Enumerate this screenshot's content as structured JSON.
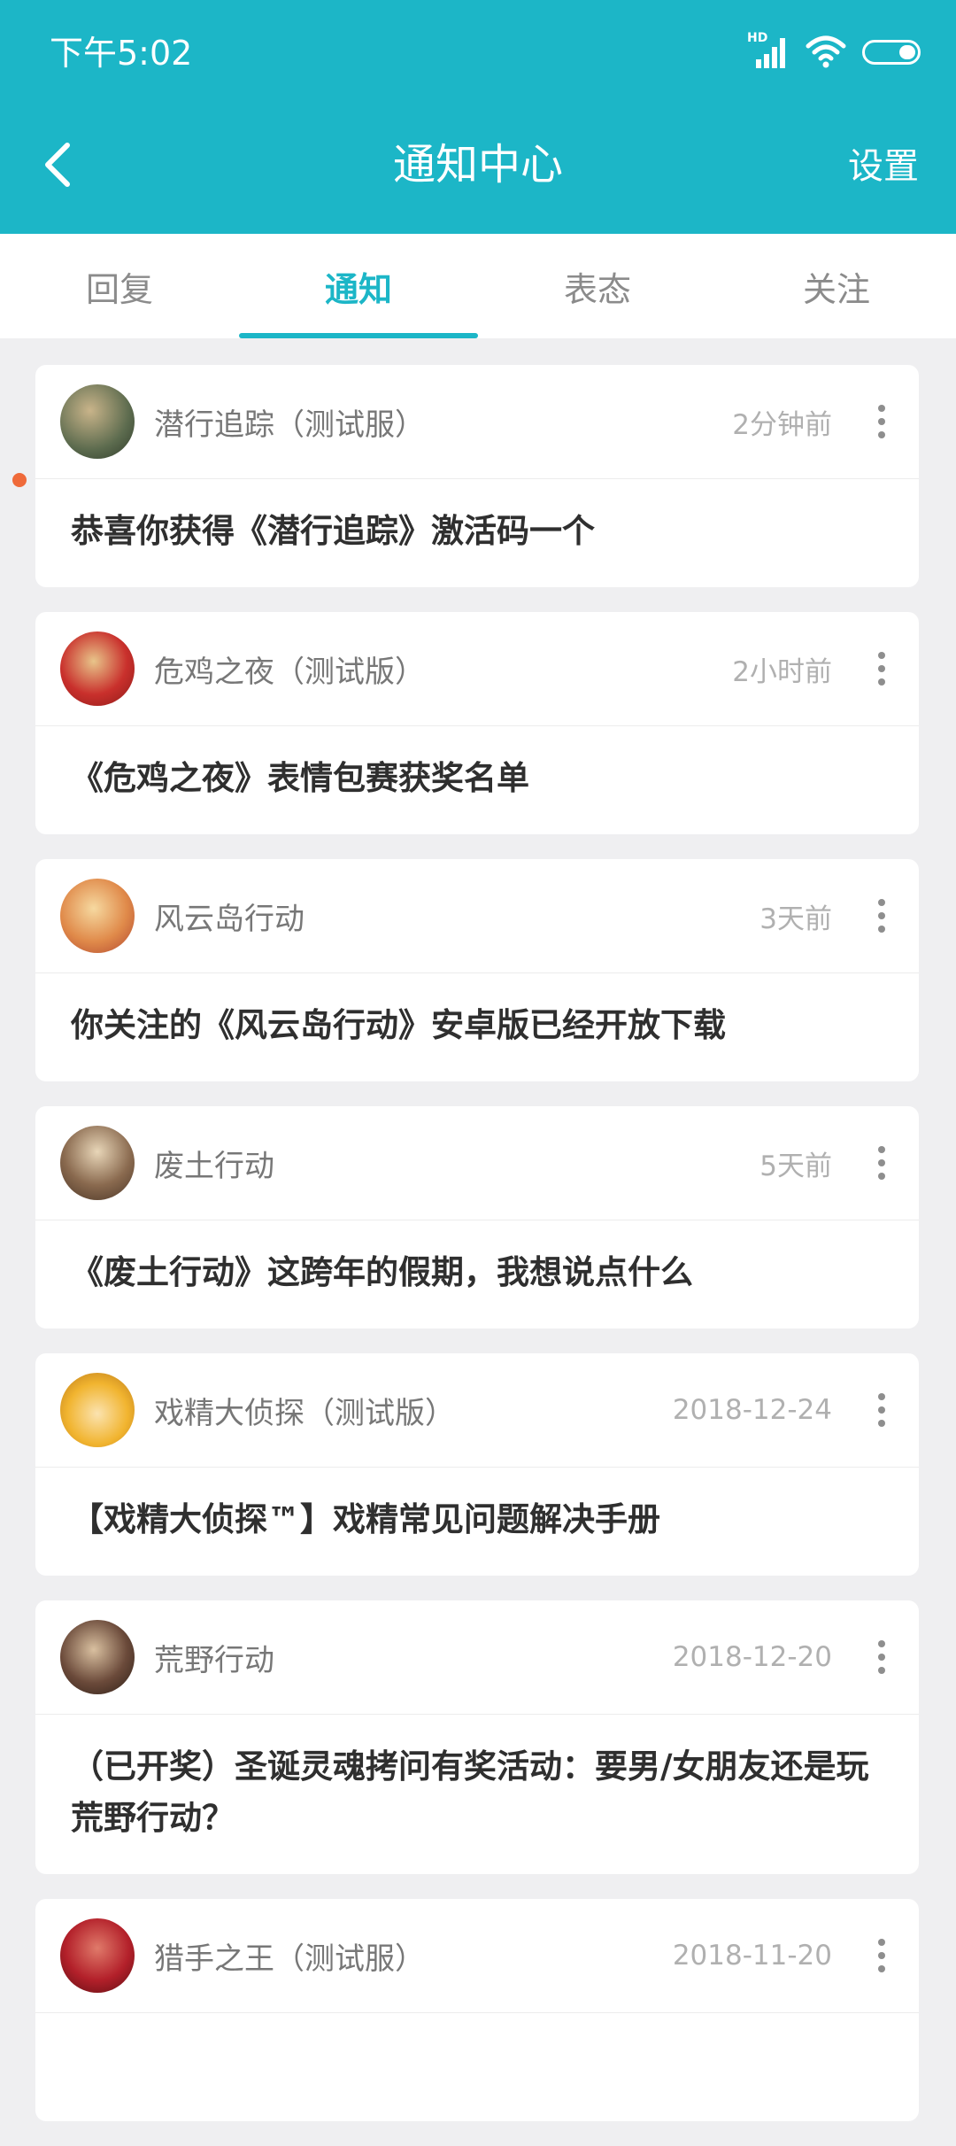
{
  "status": {
    "time": "下午5:02",
    "hd": "HD"
  },
  "header": {
    "title": "通知中心",
    "settings_label": "设置"
  },
  "tabs": [
    {
      "label": "回复",
      "active": false
    },
    {
      "label": "通知",
      "active": true
    },
    {
      "label": "表态",
      "active": false
    },
    {
      "label": "关注",
      "active": false
    }
  ],
  "notifications": [
    {
      "game": "潜行追踪（测试服）",
      "time": "2分钟前",
      "content": "恭喜你获得《潜行追踪》激活码一个",
      "avatar_color": "#5c6b4e",
      "unread": true
    },
    {
      "game": "危鸡之夜（测试版）",
      "time": "2小时前",
      "content": "《危鸡之夜》表情包赛获奖名单",
      "avatar_color": "#c9302c",
      "unread": false
    },
    {
      "game": "风云岛行动",
      "time": "3天前",
      "content": "你关注的《风云岛行动》安卓版已经开放下载",
      "avatar_color": "#e08a4a",
      "unread": false
    },
    {
      "game": "废土行动",
      "time": "5天前",
      "content": "《废土行动》这跨年的假期，我想说点什么",
      "avatar_color": "#8a6a4f",
      "unread": false
    },
    {
      "game": "戏精大侦探（测试版）",
      "time": "2018-12-24",
      "content": "【戏精大侦探™】戏精常见问题解决手册",
      "avatar_color": "#f1b42f",
      "unread": false
    },
    {
      "game": "荒野行动",
      "time": "2018-12-20",
      "content": "（已开奖）圣诞灵魂拷问有奖活动：要男/女朋友还是玩荒野行动？",
      "avatar_color": "#6b4a3a",
      "unread": false
    },
    {
      "game": "猎手之王（测试服）",
      "time": "2018-11-20",
      "content": "",
      "avatar_color": "#b3202a",
      "unread": false
    }
  ]
}
